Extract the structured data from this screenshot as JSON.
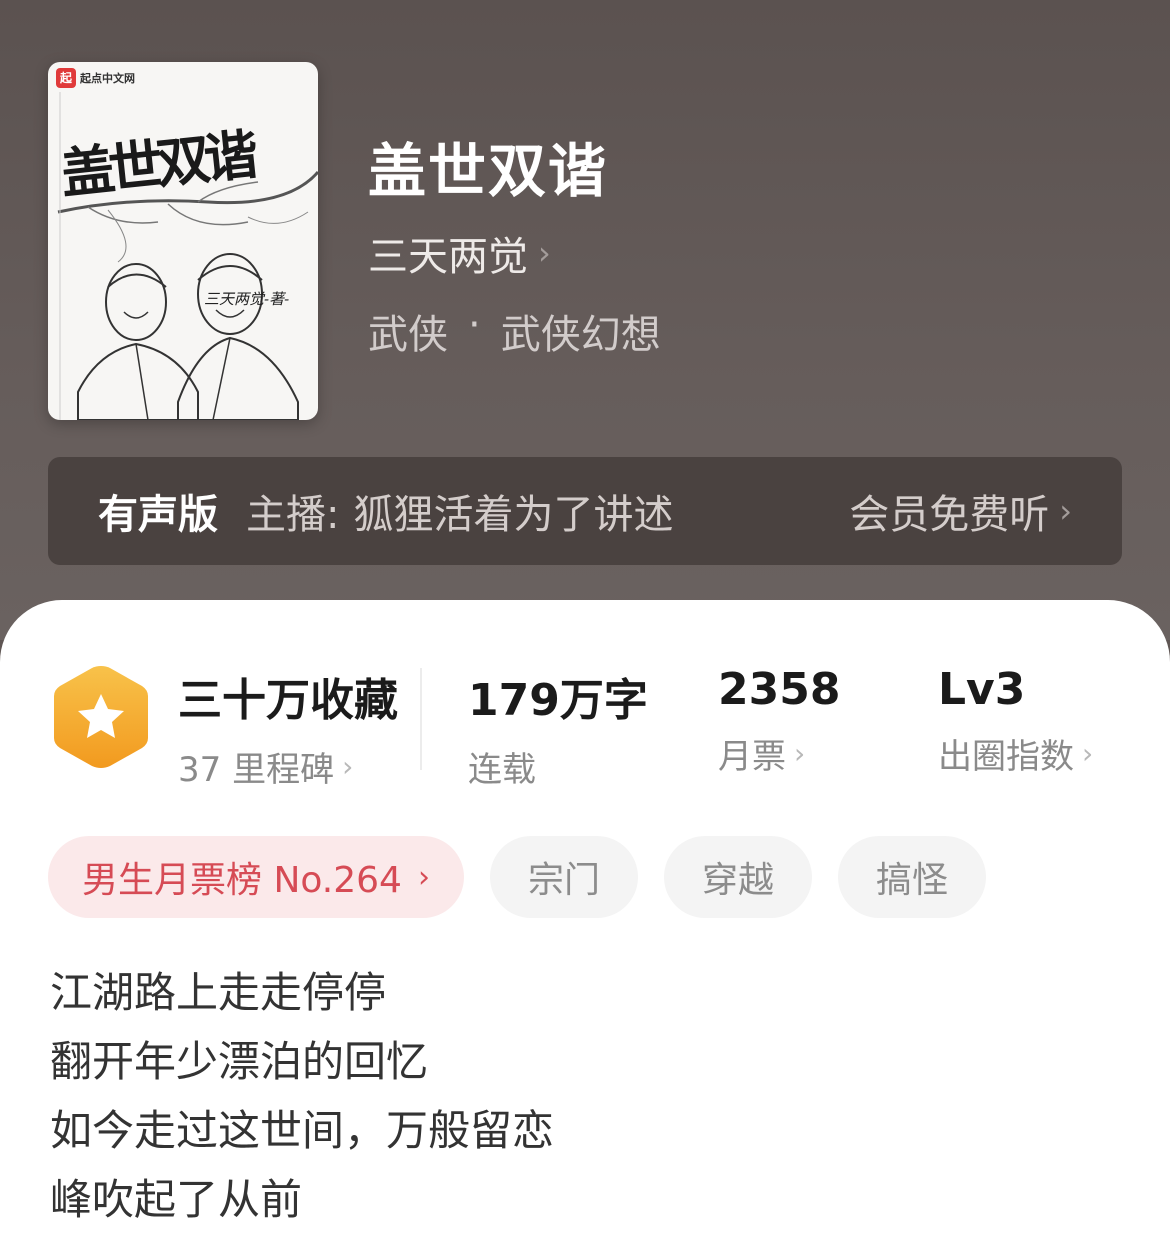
{
  "cover": {
    "brand": "起点中文网",
    "logo_char": "起",
    "title_art": "盖世双谐",
    "author_art": "三天两觉-著-"
  },
  "book": {
    "title": "盖世双谐",
    "author": "三天两觉",
    "genre_main": "武侠",
    "genre_sep": "·",
    "genre_sub": "武侠幻想"
  },
  "audio": {
    "label": "有声版",
    "host_label": "主播:",
    "host_name": "狐狸活着为了讲述",
    "cta": "会员免费听"
  },
  "stats": {
    "collect_main": "三十万收藏",
    "collect_sub": "37 里程碑",
    "words_num": "179",
    "words_unit": "万字",
    "words_sub": "连载",
    "tickets_num": "2358",
    "tickets_sub": "月票",
    "level_num": "Lv3",
    "level_sub": "出圈指数"
  },
  "tags": {
    "rank": "男生月票榜 No.264",
    "items": [
      "宗门",
      "穿越",
      "搞怪"
    ]
  },
  "intro": [
    "江湖路上走走停停",
    "翻开年少漂泊的回忆",
    "如今走过这世间，万般留恋",
    "峰吹起了从前"
  ],
  "colors": {
    "hero_bg": "#5f5654",
    "audio_bg": "#4a4240",
    "rank_tag_bg": "#fbe9ea",
    "rank_tag_text": "#d64b55",
    "badge_orange": "#f5a623"
  },
  "icons": {
    "chevron": "›",
    "badge": "star-badge-icon"
  }
}
